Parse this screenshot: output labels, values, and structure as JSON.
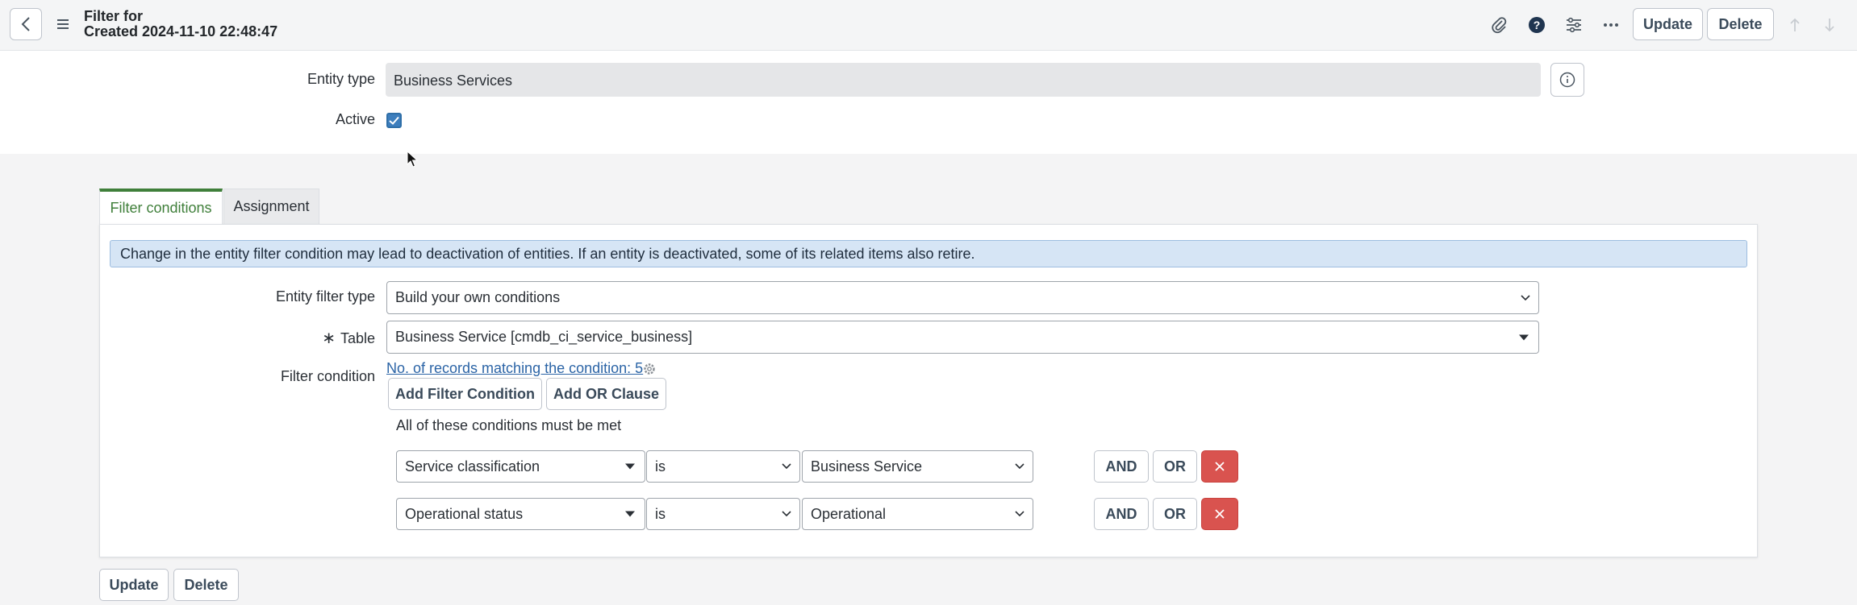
{
  "header": {
    "title_line1": "Filter for",
    "title_line2": "Created 2024-11-10 22:48:47",
    "update_label": "Update",
    "delete_label": "Delete"
  },
  "form": {
    "entity_type_label": "Entity type",
    "entity_type_value": "Business Services",
    "active_label": "Active",
    "active_checked": true
  },
  "tabs": [
    {
      "label": "Filter conditions",
      "active": true
    },
    {
      "label": "Assignment",
      "active": false
    }
  ],
  "panel": {
    "alert_text": "Change in the entity filter condition may lead to deactivation of entities. If an entity is deactivated, some of its related items also retire.",
    "entity_filter_type_label": "Entity filter type",
    "entity_filter_type_value": "Build your own conditions",
    "table_label": "Table",
    "table_value": "Business Service [cmdb_ci_service_business]",
    "filter_condition_label": "Filter condition",
    "records_link": "No. of records matching the condition: 5",
    "add_filter_condition_label": "Add Filter Condition",
    "add_or_clause_label": "Add OR Clause",
    "conditions_caption": "All of these conditions must be met",
    "conditions": [
      {
        "field": "Service classification",
        "operator": "is",
        "value": "Business Service",
        "and_label": "AND",
        "or_label": "OR"
      },
      {
        "field": "Operational status",
        "operator": "is",
        "value": "Operational",
        "and_label": "AND",
        "or_label": "OR"
      }
    ]
  },
  "footer": {
    "update_label": "Update",
    "delete_label": "Delete"
  },
  "colors": {
    "accent_green": "#3f7f3a",
    "link_blue": "#2b64a6",
    "delete_red": "#d9534f",
    "alert_bg": "#d6e5f5"
  }
}
